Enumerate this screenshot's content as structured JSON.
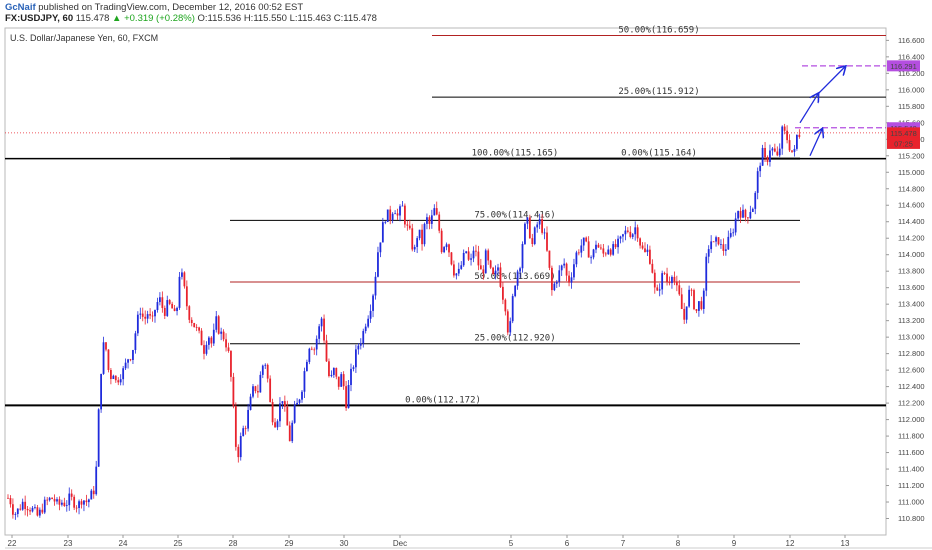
{
  "header": {
    "author": "GcNaif",
    "published": "published on TradingView.com, December 12, 2016 00:52 EST",
    "symbol": "FX:USDJPY, 60",
    "last": "115.478",
    "change": "+0.319 (+0.28%)",
    "ohlc": "O:115.536 H:115.550 L:115.463 C:115.478"
  },
  "colors": {
    "up": "#1f2bdc",
    "down": "#e8232d",
    "fib_red": "#b22222",
    "fib_black": "#000000",
    "projection": "#b44ee0",
    "arrow": "#1f2bdc",
    "current_price": "#e8232d"
  },
  "chart_data": {
    "type": "candlestick",
    "title": "U.S. Dollar/Japanese Yen, 60, FXCM",
    "x_ticks": [
      "22",
      "23",
      "24",
      "25",
      "28",
      "29",
      "30",
      "Dec",
      "5",
      "6",
      "7",
      "8",
      "9",
      "12",
      "13"
    ],
    "y_ticks": [
      "110.800",
      "111.000",
      "111.200",
      "111.400",
      "111.600",
      "111.800",
      "112.000",
      "112.200",
      "112.400",
      "112.600",
      "112.800",
      "113.000",
      "113.200",
      "113.400",
      "113.600",
      "113.800",
      "114.000",
      "114.200",
      "114.400",
      "114.600",
      "114.800",
      "115.000",
      "115.200",
      "115.400",
      "115.600",
      "115.800",
      "116.000",
      "116.200",
      "116.400",
      "116.600"
    ],
    "ylim": [
      110.6,
      116.75
    ],
    "close_path": [
      [
        0,
        110.65
      ],
      [
        4,
        110.9
      ],
      [
        8,
        111.05
      ],
      [
        11,
        111.0
      ],
      [
        14,
        110.85
      ],
      [
        18,
        110.9
      ],
      [
        23,
        111.0
      ],
      [
        28,
        110.95
      ],
      [
        33,
        110.9
      ],
      [
        38,
        110.82
      ],
      [
        43,
        110.95
      ],
      [
        48,
        111.02
      ],
      [
        53,
        111.05
      ],
      [
        58,
        110.95
      ],
      [
        62,
        111.0
      ],
      [
        66,
        110.98
      ],
      [
        70,
        111.05
      ],
      [
        74,
        111.0
      ],
      [
        78,
        110.95
      ],
      [
        82,
        111.05
      ],
      [
        86,
        111.0
      ],
      [
        90,
        111.05
      ],
      [
        94,
        111.15
      ],
      [
        97,
        111.5
      ],
      [
        99,
        112.2
      ],
      [
        101,
        112.6
      ],
      [
        103,
        112.85
      ],
      [
        105,
        113.0
      ],
      [
        107,
        112.7
      ],
      [
        110,
        112.5
      ],
      [
        113,
        112.6
      ],
      [
        116,
        112.45
      ],
      [
        120,
        112.55
      ],
      [
        124,
        112.6
      ],
      [
        128,
        112.75
      ],
      [
        132,
        112.8
      ],
      [
        136,
        113.1
      ],
      [
        140,
        113.35
      ],
      [
        144,
        113.2
      ],
      [
        148,
        113.3
      ],
      [
        152,
        113.15
      ],
      [
        156,
        113.4
      ],
      [
        160,
        113.45
      ],
      [
        164,
        113.3
      ],
      [
        168,
        113.4
      ],
      [
        172,
        113.35
      ],
      [
        176,
        113.2
      ],
      [
        180,
        113.85
      ],
      [
        184,
        113.6
      ],
      [
        188,
        113.3
      ],
      [
        192,
        113.2
      ],
      [
        196,
        113.1
      ],
      [
        200,
        113.0
      ],
      [
        204,
        112.85
      ],
      [
        208,
        113.05
      ],
      [
        212,
        112.9
      ],
      [
        216,
        113.2
      ],
      [
        220,
        113.05
      ],
      [
        224,
        113.0
      ],
      [
        228,
        112.85
      ],
      [
        231,
        112.5
      ],
      [
        234,
        112.0
      ],
      [
        237,
        111.5
      ],
      [
        239,
        111.65
      ],
      [
        242,
        111.85
      ],
      [
        246,
        111.95
      ],
      [
        250,
        112.2
      ],
      [
        254,
        112.4
      ],
      [
        258,
        112.35
      ],
      [
        262,
        112.65
      ],
      [
        266,
        112.7
      ],
      [
        270,
        112.2
      ],
      [
        274,
        111.95
      ],
      [
        278,
        112.05
      ],
      [
        282,
        112.3
      ],
      [
        286,
        112.0
      ],
      [
        290,
        111.75
      ],
      [
        294,
        112.1
      ],
      [
        298,
        112.2
      ],
      [
        302,
        112.4
      ],
      [
        306,
        112.7
      ],
      [
        310,
        112.95
      ],
      [
        314,
        112.85
      ],
      [
        318,
        113.05
      ],
      [
        322,
        113.25
      ],
      [
        326,
        112.75
      ],
      [
        330,
        112.45
      ],
      [
        334,
        112.6
      ],
      [
        338,
        112.4
      ],
      [
        342,
        112.55
      ],
      [
        346,
        112.2
      ],
      [
        350,
        112.5
      ],
      [
        354,
        112.7
      ],
      [
        358,
        112.9
      ],
      [
        362,
        113.0
      ],
      [
        366,
        113.2
      ],
      [
        370,
        113.35
      ],
      [
        374,
        113.6
      ],
      [
        378,
        114.05
      ],
      [
        382,
        114.3
      ],
      [
        386,
        114.5
      ],
      [
        390,
        114.45
      ],
      [
        394,
        114.6
      ],
      [
        398,
        114.45
      ],
      [
        402,
        114.6
      ],
      [
        406,
        114.35
      ],
      [
        410,
        114.25
      ],
      [
        414,
        114.0
      ],
      [
        418,
        114.3
      ],
      [
        422,
        114.15
      ],
      [
        426,
        114.45
      ],
      [
        430,
        114.35
      ],
      [
        434,
        114.55
      ],
      [
        438,
        114.4
      ],
      [
        442,
        114.05
      ],
      [
        446,
        114.2
      ],
      [
        450,
        114.0
      ],
      [
        454,
        113.8
      ],
      [
        458,
        113.75
      ],
      [
        462,
        113.9
      ],
      [
        466,
        114.05
      ],
      [
        470,
        113.85
      ],
      [
        474,
        114.1
      ],
      [
        478,
        113.9
      ],
      [
        482,
        113.75
      ],
      [
        486,
        114.0
      ],
      [
        490,
        113.8
      ],
      [
        494,
        113.7
      ],
      [
        498,
        113.85
      ],
      [
        502,
        113.55
      ],
      [
        506,
        113.35
      ],
      [
        509,
        112.95
      ],
      [
        512,
        113.4
      ],
      [
        516,
        113.75
      ],
      [
        520,
        113.9
      ],
      [
        524,
        114.3
      ],
      [
        528,
        114.4
      ],
      [
        532,
        114.1
      ],
      [
        536,
        114.35
      ],
      [
        540,
        114.4
      ],
      [
        544,
        114.25
      ],
      [
        548,
        113.95
      ],
      [
        552,
        113.55
      ],
      [
        556,
        113.7
      ],
      [
        560,
        113.8
      ],
      [
        564,
        113.9
      ],
      [
        568,
        113.65
      ],
      [
        572,
        113.8
      ],
      [
        576,
        114.0
      ],
      [
        580,
        114.1
      ],
      [
        584,
        114.15
      ],
      [
        588,
        114.05
      ],
      [
        592,
        113.95
      ],
      [
        596,
        114.15
      ],
      [
        600,
        114.05
      ],
      [
        604,
        114.0
      ],
      [
        608,
        114.1
      ],
      [
        612,
        114.05
      ],
      [
        616,
        114.1
      ],
      [
        620,
        114.15
      ],
      [
        624,
        114.25
      ],
      [
        628,
        114.3
      ],
      [
        632,
        114.25
      ],
      [
        636,
        114.35
      ],
      [
        640,
        114.15
      ],
      [
        644,
        114.0
      ],
      [
        648,
        114.05
      ],
      [
        652,
        113.85
      ],
      [
        656,
        113.45
      ],
      [
        660,
        113.65
      ],
      [
        664,
        113.8
      ],
      [
        668,
        113.65
      ],
      [
        672,
        113.8
      ],
      [
        676,
        113.6
      ],
      [
        680,
        113.45
      ],
      [
        684,
        113.2
      ],
      [
        688,
        113.55
      ],
      [
        692,
        113.5
      ],
      [
        696,
        113.3
      ],
      [
        700,
        113.45
      ],
      [
        703,
        113.35
      ],
      [
        706,
        113.9
      ],
      [
        710,
        114.2
      ],
      [
        714,
        114.1
      ],
      [
        718,
        114.2
      ],
      [
        722,
        114.05
      ],
      [
        726,
        114.1
      ],
      [
        730,
        114.2
      ],
      [
        734,
        114.35
      ],
      [
        738,
        114.55
      ],
      [
        742,
        114.5
      ],
      [
        746,
        114.45
      ],
      [
        750,
        114.55
      ],
      [
        754,
        114.6
      ],
      [
        758,
        115.0
      ],
      [
        762,
        115.25
      ],
      [
        766,
        115.1
      ],
      [
        770,
        115.3
      ],
      [
        774,
        115.25
      ],
      [
        778,
        115.15
      ],
      [
        782,
        115.5
      ],
      [
        786,
        115.45
      ],
      [
        790,
        115.3
      ],
      [
        794,
        115.2
      ],
      [
        797,
        115.45
      ],
      [
        800,
        115.48
      ]
    ],
    "fib_levels": [
      {
        "label": "50.00%(116.659)",
        "price": 116.659,
        "x0": 432,
        "x1": 886,
        "color_key": "fib_red"
      },
      {
        "label": "25.00%(115.912)",
        "price": 115.912,
        "x0": 432,
        "x1": 886,
        "color_key": "fib_black"
      },
      {
        "label": "0.00%(115.164)",
        "price": 115.164,
        "x0": 432,
        "x1": 886,
        "color_key": "fib_black"
      },
      {
        "label": "100.00%(115.165)",
        "price": 115.165,
        "x0": 230,
        "x1": 800,
        "color_key": "fib_black"
      },
      {
        "label": "75.00%(114.416)",
        "price": 114.416,
        "x0": 230,
        "x1": 800,
        "color_key": "fib_black"
      },
      {
        "label": "50.00%(113.669)",
        "price": 113.669,
        "x0": 230,
        "x1": 800,
        "color_key": "fib_red"
      },
      {
        "label": "25.00%(112.920)",
        "price": 112.92,
        "x0": 230,
        "x1": 800,
        "color_key": "fib_black"
      },
      {
        "label": "0.00%(112.172)",
        "price": 112.172,
        "x0": 0,
        "x1": 886,
        "color_key": "fib_black"
      }
    ],
    "full_width_lines": [
      115.165,
      112.172
    ],
    "projection_targets": [
      116.291,
      115.54
    ],
    "price_tags": [
      {
        "label": "116.291",
        "price": 116.291,
        "color_key": "projection"
      },
      {
        "label": "115.540",
        "price": 115.54,
        "color_key": "projection"
      },
      {
        "label": "115.478",
        "price": 115.478,
        "color_key": "current_price"
      },
      {
        "label": "07:25",
        "price": 115.35,
        "color_key": "current_price"
      }
    ]
  }
}
